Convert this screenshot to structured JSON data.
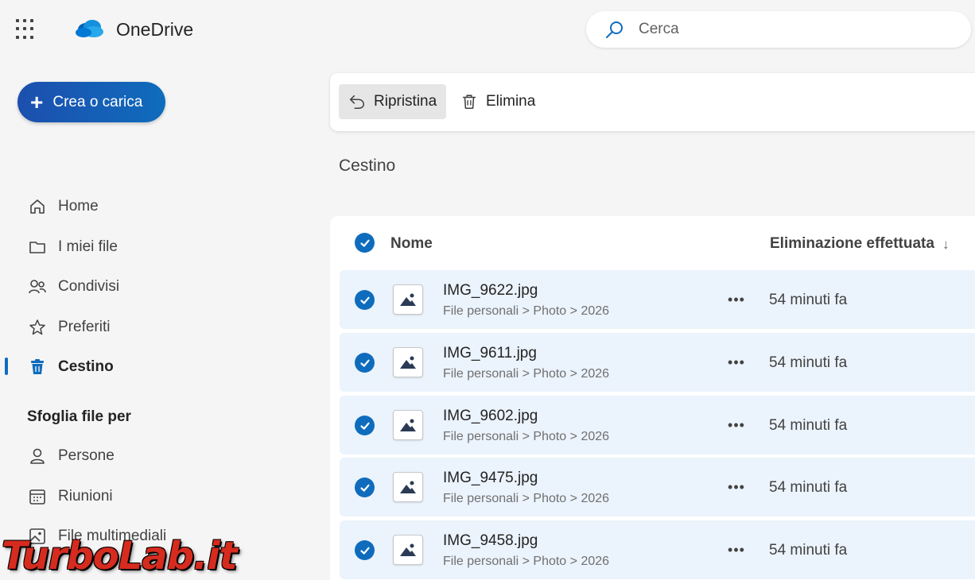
{
  "app": {
    "name": "OneDrive",
    "brand_color": "#0f6cbd"
  },
  "search": {
    "placeholder": "Cerca"
  },
  "create_button": {
    "label": "Crea o carica"
  },
  "sidebar": {
    "items": [
      {
        "label": "Home",
        "icon": "home-icon"
      },
      {
        "label": "I miei file",
        "icon": "folder-icon"
      },
      {
        "label": "Condivisi",
        "icon": "people-icon"
      },
      {
        "label": "Preferiti",
        "icon": "star-icon"
      },
      {
        "label": "Cestino",
        "icon": "trash-icon",
        "active": true
      }
    ],
    "browse_heading": "Sfoglia file per",
    "browse_items": [
      {
        "label": "Persone",
        "icon": "person-icon"
      },
      {
        "label": "Riunioni",
        "icon": "calendar-icon"
      },
      {
        "label": "File multimediali",
        "icon": "image-icon"
      }
    ]
  },
  "toolbar": {
    "restore_label": "Ripristina",
    "delete_label": "Elimina"
  },
  "page": {
    "title": "Cestino"
  },
  "list": {
    "columns": {
      "name": "Nome",
      "deleted": "Eliminazione effettuata"
    },
    "sort_icon": "↓",
    "rows": [
      {
        "name": "IMG_9622.jpg",
        "path": "File personali > Photo > 2026",
        "deleted": "54 minuti fa",
        "selected": true
      },
      {
        "name": "IMG_9611.jpg",
        "path": "File personali > Photo > 2026",
        "deleted": "54 minuti fa",
        "selected": true
      },
      {
        "name": "IMG_9602.jpg",
        "path": "File personali > Photo > 2026",
        "deleted": "54 minuti fa",
        "selected": true
      },
      {
        "name": "IMG_9475.jpg",
        "path": "File personali > Photo > 2026",
        "deleted": "54 minuti fa",
        "selected": true
      },
      {
        "name": "IMG_9458.jpg",
        "path": "File personali > Photo > 2026",
        "deleted": "54 minuti fa",
        "selected": true
      }
    ]
  },
  "watermark": {
    "text": "TurboLab.it"
  }
}
